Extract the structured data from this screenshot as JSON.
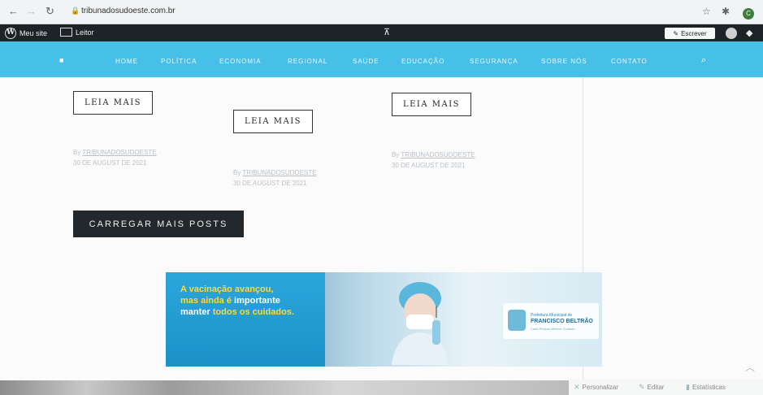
{
  "browser": {
    "url": "tribunadosudoeste.com.br",
    "back_icon": "arrow-left-icon",
    "forward_icon": "arrow-right-icon",
    "reload_icon": "reload-icon",
    "profile_initial": "C"
  },
  "wp_admin_bar": {
    "my_site": "Meu site",
    "reader": "Leitor",
    "write": "Escrever"
  },
  "nav": {
    "items": [
      "HOME",
      "POLÍTICA",
      "ECONOMIA",
      "REGIONAL",
      "SAÚDE",
      "EDUCAÇÃO",
      "SEGURANÇA",
      "SOBRE NÓS",
      "CONTATO"
    ]
  },
  "posts": [
    {
      "button": "LEIA MAIS",
      "author": "TRIBUNADOSUDOESTE",
      "by": "By",
      "date": "30 DE AUGUST DE 2021"
    },
    {
      "button": "LEIA MAIS",
      "author": "TRIBUNADOSUDOESTE",
      "by": "By",
      "date": "30 DE AUGUST DE 2021"
    },
    {
      "button": "LEIA MAIS",
      "author": "TRIBUNADOSUDOESTE",
      "by": "By",
      "date": "30 DE AUGUST DE 2021"
    }
  ],
  "load_more": "CARREGAR MAIS POSTS",
  "banner": {
    "headline_1": "A vacinação avançou,",
    "headline_2a": "mas ainda é ",
    "headline_2b": "importante",
    "headline_3a": "manter ",
    "headline_3b": "todos os cuidados.",
    "logo_small": "Prefeitura Municipal de",
    "logo_name": "FRANCISCO BELTRÃO",
    "logo_tag": "Cada Pessoa Merece Cuidado"
  },
  "footer_bar": {
    "customize": "Personalizar",
    "edit": "Editar",
    "stats": "Estatísticas"
  },
  "colors": {
    "nav_bg": "#47c0e9",
    "admin_bar_bg": "#1d2327",
    "load_more_bg": "#23282d"
  }
}
